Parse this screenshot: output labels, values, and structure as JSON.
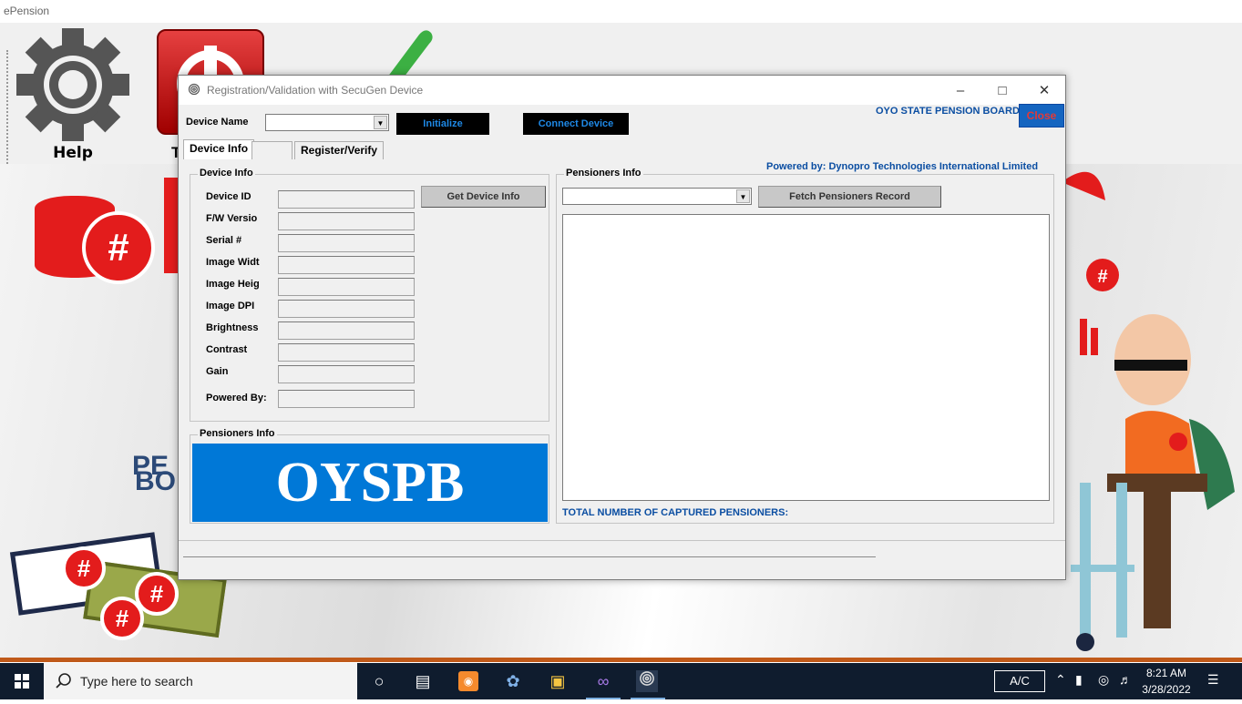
{
  "app": {
    "title": "ePension"
  },
  "toolbar": {
    "help_label": "Help",
    "power_label": "T",
    "help_icon": "gear-icon",
    "power_icon": "power-icon",
    "check_icon": "checkmark-icon"
  },
  "background": {
    "bank_text": "PE",
    "bank_text2": "BO",
    "hash": "#"
  },
  "dialog": {
    "title": "Registration/Validation with SecuGen Device",
    "device_name_label": "Device Name",
    "device_name_value": "",
    "initialize_label": "Initialize",
    "connect_label": "Connect Device",
    "org_label": "OYO STATE PENSION BOARD",
    "close_label": "Close",
    "powered_label": "Powered by: Dynopro Technologies International Limited",
    "tabs": [
      {
        "label": "Device Info"
      },
      {
        "label": ""
      },
      {
        "label": "Register/Verify"
      }
    ],
    "device_info": {
      "group_title": "Device Info",
      "get_info_label": "Get Device Info",
      "fields": [
        {
          "label": "Device ID",
          "value": ""
        },
        {
          "label": "F/W Versio",
          "value": ""
        },
        {
          "label": "Serial #",
          "value": ""
        },
        {
          "label": "Image Widt",
          "value": ""
        },
        {
          "label": "Image Heig",
          "value": ""
        },
        {
          "label": "Image DPI",
          "value": ""
        },
        {
          "label": "Brightness",
          "value": ""
        },
        {
          "label": "Contrast",
          "value": ""
        },
        {
          "label": "Gain",
          "value": ""
        },
        {
          "label": "Powered By:",
          "value": ""
        }
      ]
    },
    "pensioners_logo": {
      "group_title": "Pensioners Info",
      "logo_text": "OYSPB"
    },
    "pensioners_info": {
      "group_title": "Pensioners Info",
      "select_value": "",
      "fetch_label": "Fetch Pensioners Record",
      "total_label": "TOTAL NUMBER OF CAPTURED PENSIONERS:"
    },
    "colors": {
      "accent": "#0078d7",
      "org_text": "#0b4ea2",
      "close_text": "#e53935"
    }
  },
  "taskbar": {
    "search_placeholder": "Type here to search",
    "ac_label": "A/C",
    "time": "8:21 AM",
    "date": "3/28/2022",
    "icons": [
      "windows-start-icon",
      "search-icon",
      "cortana-icon",
      "task-view-icon",
      "camera-app-icon",
      "dolphin-app-icon",
      "file-explorer-icon",
      "visual-studio-icon",
      "fingerprint-icon",
      "chevron-up-icon",
      "battery-icon",
      "network-icon",
      "volume-icon",
      "notification-icon"
    ]
  }
}
